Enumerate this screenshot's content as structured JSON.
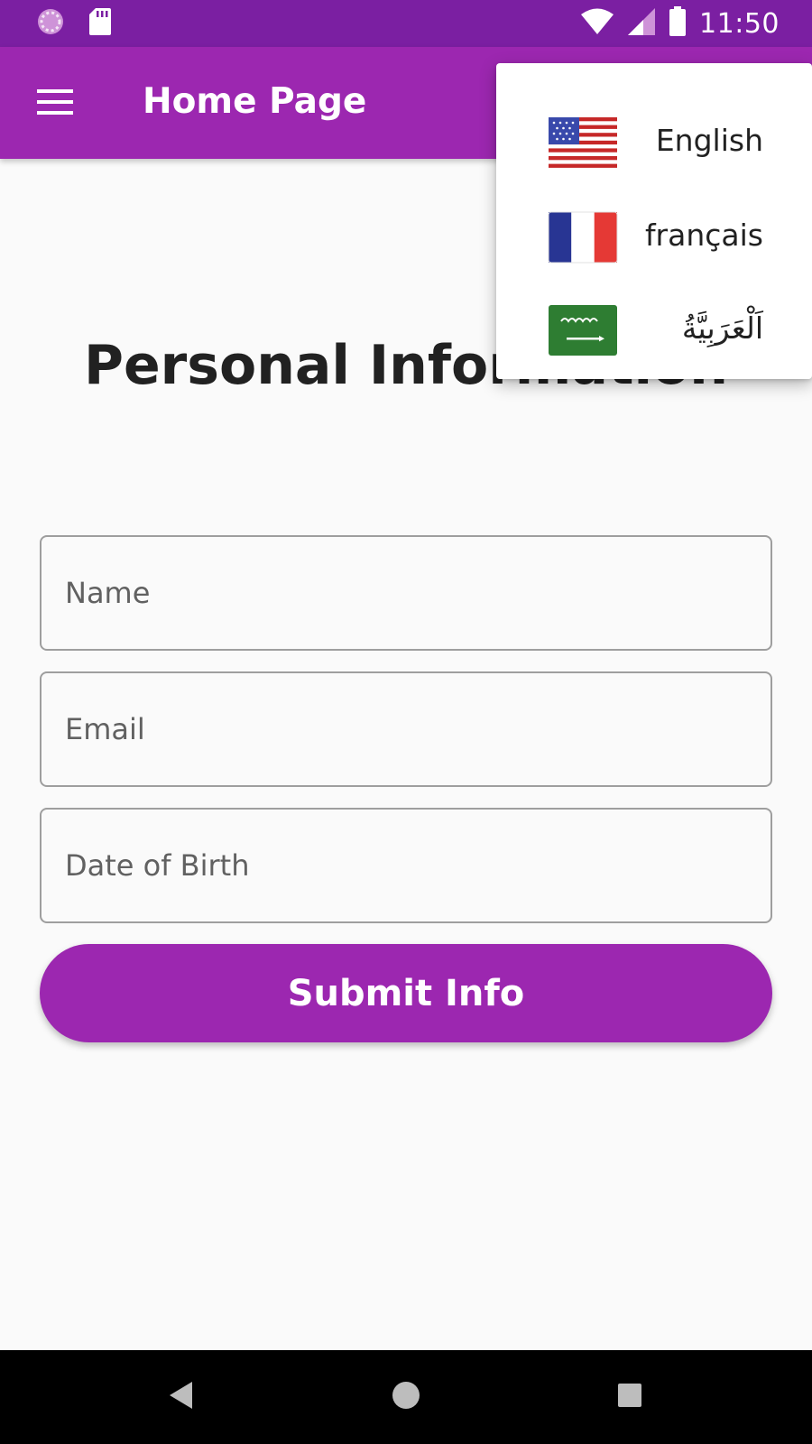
{
  "status_bar": {
    "time": "11:50",
    "icons": [
      "loading-icon",
      "sd-card-icon",
      "wifi-icon",
      "signal-icon",
      "battery-icon"
    ]
  },
  "app_bar": {
    "menu_icon": "hamburger-menu-icon",
    "title": "Home Page"
  },
  "main": {
    "heading": "Personal Information",
    "fields": {
      "name": {
        "placeholder": "Name",
        "value": ""
      },
      "email": {
        "placeholder": "Email",
        "value": ""
      },
      "dob": {
        "placeholder": "Date of Birth",
        "value": ""
      }
    },
    "submit_label": "Submit Info"
  },
  "language_menu": {
    "items": [
      {
        "label": "English",
        "flag": "us-flag-icon"
      },
      {
        "label": "français",
        "flag": "france-flag-icon"
      },
      {
        "label": "اَلْعَرَبِيَّةُ",
        "flag": "saudi-flag-icon"
      }
    ]
  },
  "nav_bar": {
    "icons": [
      "back-icon",
      "home-icon",
      "recents-icon"
    ]
  },
  "colors": {
    "status_bar": "#7b1fa2",
    "primary": "#9c27b0",
    "background": "#fafafa",
    "nav_bar": "#000000"
  }
}
